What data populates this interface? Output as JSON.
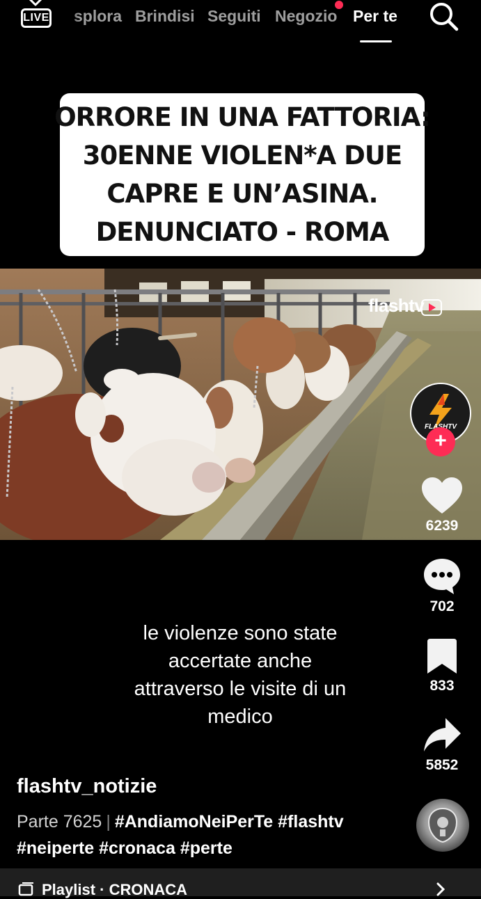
{
  "nav": {
    "live_label": "LIVE",
    "tabs": [
      {
        "label": "Esplora",
        "visible_text": "splora",
        "active": false
      },
      {
        "label": "Brindisi",
        "active": false
      },
      {
        "label": "Seguiti",
        "active": false
      },
      {
        "label": "Negozio",
        "active": false,
        "notification_dot": true
      },
      {
        "label": "Per te",
        "active": true
      }
    ],
    "search_icon": "search-icon"
  },
  "headline": {
    "lines": [
      "ORRORE IN UNA FATTORIA:",
      "30ENNE VIOLEN*A DUE",
      "CAPRE E UN’ASINA.",
      "DENUNCIATO - ROMA"
    ]
  },
  "video": {
    "watermark": "flashtv"
  },
  "rail": {
    "avatar_label": "FLASHTV",
    "follow_icon": "plus-icon",
    "likes": "6239",
    "comments": "702",
    "bookmarks": "833",
    "shares": "5852"
  },
  "subtitle": {
    "lines": [
      "le violenze sono state",
      "accertate anche",
      "attraverso le visite di un",
      "medico"
    ]
  },
  "post": {
    "author": "flashtv_notizie",
    "part": "Parte 7625",
    "tags_line1": "#AndiamoNeiPerTe #flashtv",
    "tags_line2": "#neiperte #cronaca #perte"
  },
  "playlist": {
    "label": "Playlist · CRONACA"
  },
  "colors": {
    "accent": "#fe2c55",
    "background": "#000000"
  }
}
